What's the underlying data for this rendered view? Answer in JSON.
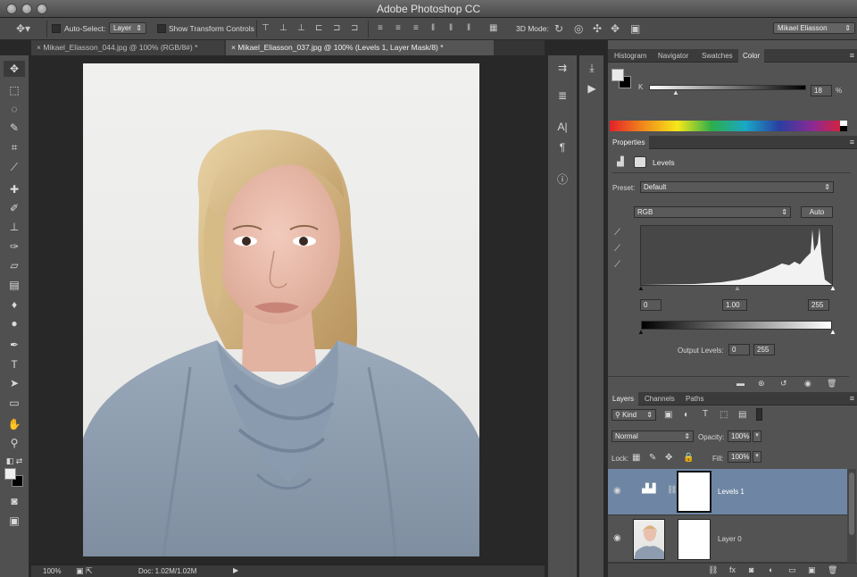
{
  "app": {
    "title": "Adobe Photoshop CC",
    "workspace": "Mikael Eliasson"
  },
  "options_bar": {
    "auto_select_label": "Auto-Select:",
    "auto_select_value": "Layer",
    "show_transform_label": "Show Transform Controls",
    "mode3d_label": "3D Mode:"
  },
  "tabs": [
    {
      "label": "Mikael_Eliasson_044.jpg @ 100% (RGB/8#) *",
      "active": false
    },
    {
      "label": "Mikael_Eliasson_037.jpg @ 100% (Levels 1, Layer Mask/8) *",
      "active": true
    }
  ],
  "status": {
    "zoom": "100%",
    "doc": "Doc: 1.02M/1.02M"
  },
  "color_panel": {
    "tabs": [
      "Histogram",
      "Navigator",
      "Swatches",
      "Color"
    ],
    "active_tab": "Color",
    "channel_label": "K",
    "value": "18",
    "unit": "%"
  },
  "properties_panel": {
    "title": "Properties",
    "adjustment": "Levels",
    "preset_label": "Preset:",
    "preset_value": "Default",
    "channel": "RGB",
    "auto_label": "Auto",
    "input_black": "0",
    "input_gamma": "1.00",
    "input_white": "255",
    "output_label": "Output Levels:",
    "output_black": "0",
    "output_white": "255"
  },
  "layers_panel": {
    "tabs": [
      "Layers",
      "Channels",
      "Paths"
    ],
    "active_tab": "Layers",
    "filter_kind": "Kind",
    "blend_mode": "Normal",
    "opacity_label": "Opacity:",
    "opacity_value": "100%",
    "lock_label": "Lock:",
    "fill_label": "Fill:",
    "fill_value": "100%",
    "layers": [
      {
        "name": "Levels 1",
        "selected": true
      },
      {
        "name": "Layer 0",
        "selected": false
      }
    ]
  },
  "colors": {
    "selected_layer": "#6e86a3",
    "panel_bg": "#535353"
  }
}
